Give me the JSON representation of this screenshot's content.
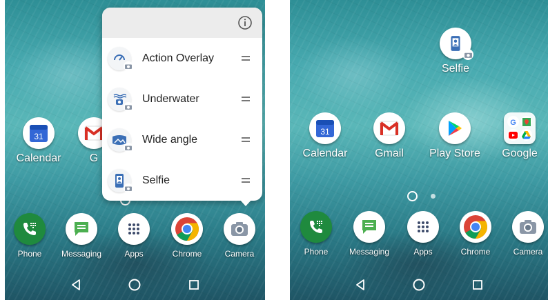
{
  "left_screen": {
    "popup": {
      "items": [
        {
          "label": "Action Overlay",
          "icon": "action-overlay-icon"
        },
        {
          "label": "Underwater",
          "icon": "underwater-icon"
        },
        {
          "label": "Wide angle",
          "icon": "wide-angle-icon"
        },
        {
          "label": "Selfie",
          "icon": "selfie-icon"
        }
      ]
    },
    "home_apps": [
      {
        "label": "Calendar",
        "icon": "calendar-icon",
        "badge": "31"
      },
      {
        "label": "G",
        "icon": "gmail-icon"
      }
    ],
    "dock": [
      {
        "label": "Phone",
        "icon": "phone-icon"
      },
      {
        "label": "Messaging",
        "icon": "messaging-icon"
      },
      {
        "label": "Apps",
        "icon": "apps-grid-icon"
      },
      {
        "label": "Chrome",
        "icon": "chrome-icon"
      },
      {
        "label": "Camera",
        "icon": "camera-icon"
      }
    ]
  },
  "right_screen": {
    "shortcut": {
      "label": "Selfie",
      "icon": "selfie-icon"
    },
    "home_apps": [
      {
        "label": "Calendar",
        "icon": "calendar-icon",
        "badge": "31"
      },
      {
        "label": "Gmail",
        "icon": "gmail-icon"
      },
      {
        "label": "Play Store",
        "icon": "play-store-icon"
      },
      {
        "label": "Google",
        "icon": "google-folder-icon"
      }
    ],
    "dock": [
      {
        "label": "Phone",
        "icon": "phone-icon"
      },
      {
        "label": "Messaging",
        "icon": "messaging-icon"
      },
      {
        "label": "Apps",
        "icon": "apps-grid-icon"
      },
      {
        "label": "Chrome",
        "icon": "chrome-icon"
      },
      {
        "label": "Camera",
        "icon": "camera-icon"
      }
    ]
  },
  "nav": [
    "back-icon",
    "home-icon",
    "recents-icon"
  ],
  "colors": {
    "wallpaper": "#48aab0",
    "phone_green": "#1f8a3e",
    "messaging_green": "#4caf50",
    "gmail_red": "#d93025",
    "calendar_blue": "#4285f4"
  }
}
